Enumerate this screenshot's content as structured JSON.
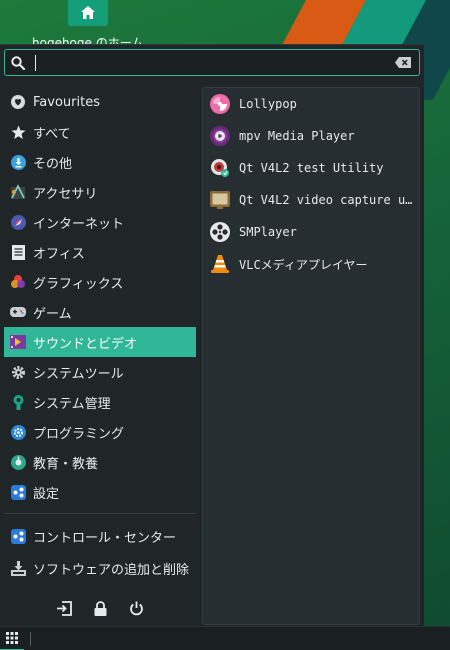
{
  "desktop": {
    "home_label": "hogehoge のホーム",
    "home_icon": "home-icon"
  },
  "search": {
    "value": "",
    "placeholder": "",
    "search_icon": "search-icon",
    "clear_icon": "backspace-icon"
  },
  "categories": [
    {
      "label": "Favourites",
      "icon": "favourites-icon"
    },
    {
      "label": "すべて",
      "icon": "star-icon"
    },
    {
      "label": "その他",
      "icon": "download-icon"
    },
    {
      "label": "アクセサリ",
      "icon": "accessories-icon"
    },
    {
      "label": "インターネット",
      "icon": "internet-icon"
    },
    {
      "label": "オフィス",
      "icon": "office-icon"
    },
    {
      "label": "グラフィックス",
      "icon": "graphics-icon"
    },
    {
      "label": "ゲーム",
      "icon": "gamepad-icon"
    },
    {
      "label": "サウンドとビデオ",
      "icon": "multimedia-icon",
      "selected": true
    },
    {
      "label": "システムツール",
      "icon": "gear-icon"
    },
    {
      "label": "システム管理",
      "icon": "system-admin-icon"
    },
    {
      "label": "プログラミング",
      "icon": "programming-icon"
    },
    {
      "label": "教育・教養",
      "icon": "education-icon"
    },
    {
      "label": "設定",
      "icon": "settings-icon"
    }
  ],
  "system_items": [
    {
      "label": "コントロール・センター",
      "icon": "control-center-icon"
    },
    {
      "label": "ソフトウェアの追加と削除",
      "icon": "software-install-icon"
    }
  ],
  "bottom_actions": [
    {
      "name": "logout-icon"
    },
    {
      "name": "lock-icon"
    },
    {
      "name": "power-icon"
    }
  ],
  "apps": [
    {
      "label": "Lollypop",
      "icon": "lollypop-icon"
    },
    {
      "label": "mpv Media Player",
      "icon": "mpv-icon"
    },
    {
      "label": "Qt V4L2 test Utility",
      "icon": "qv4l2-icon"
    },
    {
      "label": "Qt V4L2 video capture u…",
      "icon": "v4l2-capture-icon"
    },
    {
      "label": "SMPlayer",
      "icon": "smplayer-icon"
    },
    {
      "label": "VLCメディアプレイヤー",
      "icon": "vlc-icon"
    }
  ],
  "colors": {
    "accent": "#2fb798",
    "panel": "#202628",
    "app_panel": "#262e31"
  },
  "taskbar": {
    "menu_icon": "app-grid-icon"
  }
}
